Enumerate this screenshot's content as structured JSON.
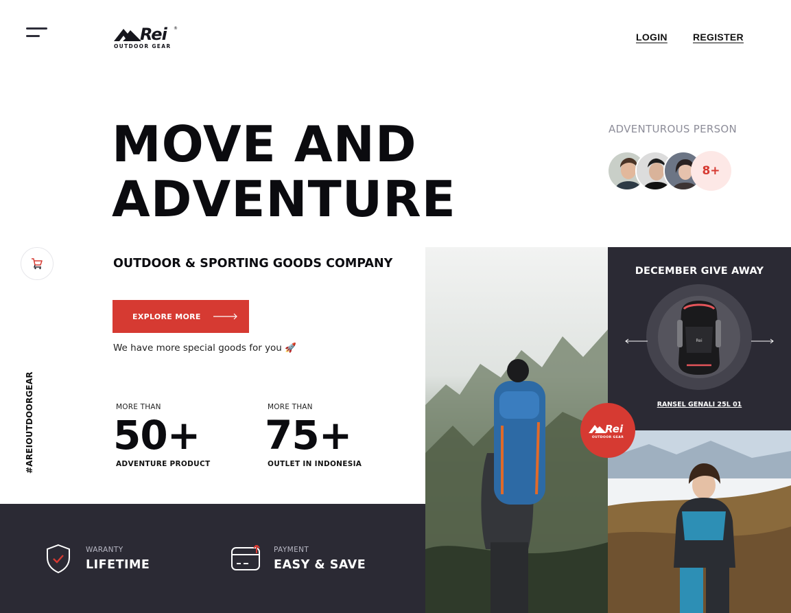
{
  "header": {
    "logo_brand": "Rei",
    "logo_sub": "OUTDOOR GEAR",
    "login_label": "LOGIN",
    "register_label": "REGISTER"
  },
  "hero": {
    "title_line1": "MOVE AND",
    "title_line2": "ADVENTURE",
    "tagline": "OUTDOOR & SPORTING GOODS COMPANY",
    "cta_label": "EXPLORE MORE",
    "special_text": "We have more special goods for you 🚀"
  },
  "side": {
    "hashtag": "#AREIOUTDOORGEAR",
    "cart_icon": "cart-icon"
  },
  "stats": [
    {
      "prefix": "MORE THAN",
      "value": "50+",
      "label": "ADVENTURE PRODUCT"
    },
    {
      "prefix": "MORE THAN",
      "value": "75+",
      "label": "OUTLET IN INDONESIA"
    }
  ],
  "adventurous": {
    "label": "ADVENTUROUS PERSON",
    "more_count": "8+"
  },
  "features": [
    {
      "small": "WARANTY",
      "big": "LIFETIME",
      "icon": "shield-check-icon"
    },
    {
      "small": "PAYMENT",
      "big": "EASY & SAVE",
      "icon": "card-payment-icon"
    }
  ],
  "giveaway": {
    "title": "DECEMBER GIVE AWAY",
    "product_name": "RANSEL GENALI 25L 01"
  },
  "colors": {
    "accent": "#d63a32",
    "dark": "#2b2a34",
    "text": "#0b0b0f",
    "muted": "#8d8d99"
  }
}
